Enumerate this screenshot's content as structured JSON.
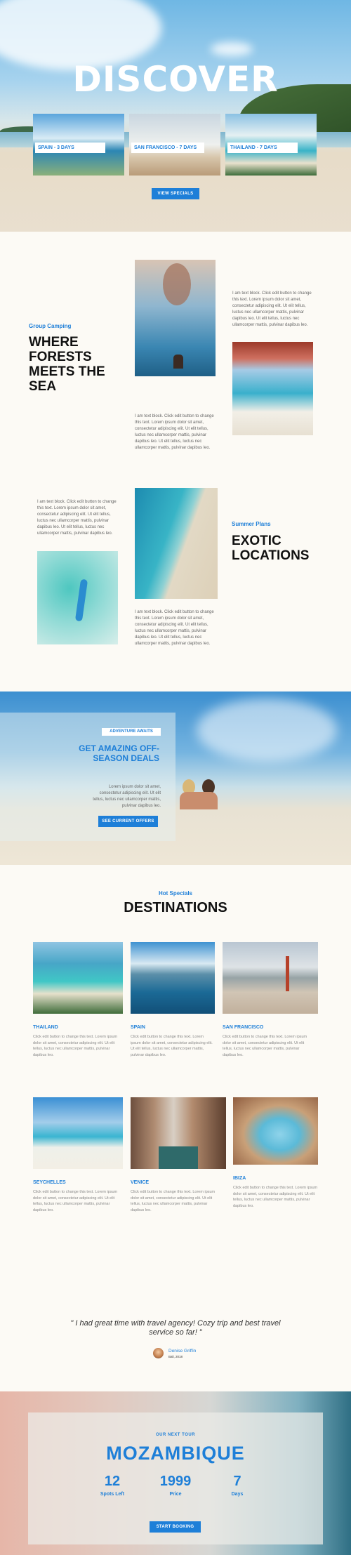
{
  "hero": {
    "title": "DISCOVER",
    "tours": [
      "SPAIN - 3 DAYS",
      "SAN FRANCISCO - 7 DAYS",
      "THAILAND - 7 DAYS"
    ],
    "cta": "VIEW SPECIALS"
  },
  "camping": {
    "kicker": "Group Camping",
    "title": "WHERE FORESTS MEETS THE SEA",
    "text1": "I am text block. Click edit button to change this text. Lorem ipsum dolor sit amet, consectetur adipiscing elit. Ut elit tellus, luctus nec ullamcorper mattis, pulvinar dapibus leo. Ut elit tellus, luctus nec ullamcorper mattis, pulvinar dapibus leo.",
    "text2": "I am text block. Click edit button to change this text. Lorem ipsum dolor sit amet, consectetur adipiscing elit. Ut elit tellus, luctus nec ullamcorper mattis, pulvinar dapibus leo. Ut elit tellus, luctus nec ullamcorper mattis, pulvinar dapibus leo."
  },
  "exotic": {
    "kicker": "Summer Plans",
    "title": "EXOTIC LOCATIONS",
    "text1": "I am text block. Click edit button to change this text. Lorem ipsum dolor sit amet, consectetur adipiscing elit. Ut elit tellus, luctus nec ullamcorper mattis, pulvinar dapibus leo. Ut elit tellus, luctus nec ullamcorper mattis, pulvinar dapibus leo.",
    "text2": "I am text block. Click edit button to change this text. Lorem ipsum dolor sit amet, consectetur adipiscing elit. Ut elit tellus, luctus nec ullamcorper mattis, pulvinar dapibus leo. Ut elit tellus, luctus nec ullamcorper mattis, pulvinar dapibus leo."
  },
  "offer": {
    "badge": "ADVENTURE AWAITS",
    "title": "GET AMAZING OFF-SEASON DEALS",
    "text": "Lorem ipsum dolor sit amet, consectetur adipiscing elit. Ut elit tellus, luctus nec ullamcorper mattis, pulvinar dapibus leo.",
    "cta": "SEE CURRENT OFFERS"
  },
  "destinations": {
    "kicker": "Hot Specials",
    "title": "DESTINATIONS",
    "items": [
      {
        "name": "THAILAND",
        "text": "Click edit button to change this text. Lorem ipsum dolor sit amet, consectetur adipiscing elit. Ut elit tellus, luctus nec ullamcorper mattis, pulvinar dapibus leo."
      },
      {
        "name": "SPAIN",
        "text": "Click edit button to change this text. Lorem ipsum dolor sit amet, consectetur adipiscing elit. Ut elit tellus, luctus nec ullamcorper mattis, pulvinar dapibus leo."
      },
      {
        "name": "SAN FRANCISCO",
        "text": "Click edit button to change this text. Lorem ipsum dolor sit amet, consectetur adipiscing elit. Ut elit tellus, luctus nec ullamcorper mattis, pulvinar dapibus leo."
      },
      {
        "name": "SEYCHELLES",
        "text": "Click edit button to change this text. Lorem ipsum dolor sit amet, consectetur adipiscing elit. Ut elit tellus, luctus nec ullamcorper mattis, pulvinar dapibus leo."
      },
      {
        "name": "VENICE",
        "text": "Click edit button to change this text. Lorem ipsum dolor sit amet, consectetur adipiscing elit. Ut elit tellus, luctus nec ullamcorper mattis, pulvinar dapibus leo."
      },
      {
        "name": "IBIZA",
        "text": "Click edit button to change this text. Lorem ipsum dolor sit amet, consectetur adipiscing elit. Ut elit tellus, luctus nec ullamcorper mattis, pulvinar dapibus leo."
      }
    ]
  },
  "testimonial": {
    "quote": "\" I had great time with travel agency! Cozy trip and best travel service so far! \"",
    "name": "Denise Griffin",
    "meta": "Bali, 2018"
  },
  "next_tour": {
    "kicker": "OUR NEXT TOUR",
    "title": "MOZAMBIQUE",
    "stats": [
      {
        "value": "12",
        "label": "Spots Left"
      },
      {
        "value": "1999",
        "label": "Price"
      },
      {
        "value": "7",
        "label": "Days"
      }
    ],
    "cta": "START BOOKING"
  },
  "colors": {
    "accent": "#1e7fd8",
    "background": "#fcfaf5"
  }
}
